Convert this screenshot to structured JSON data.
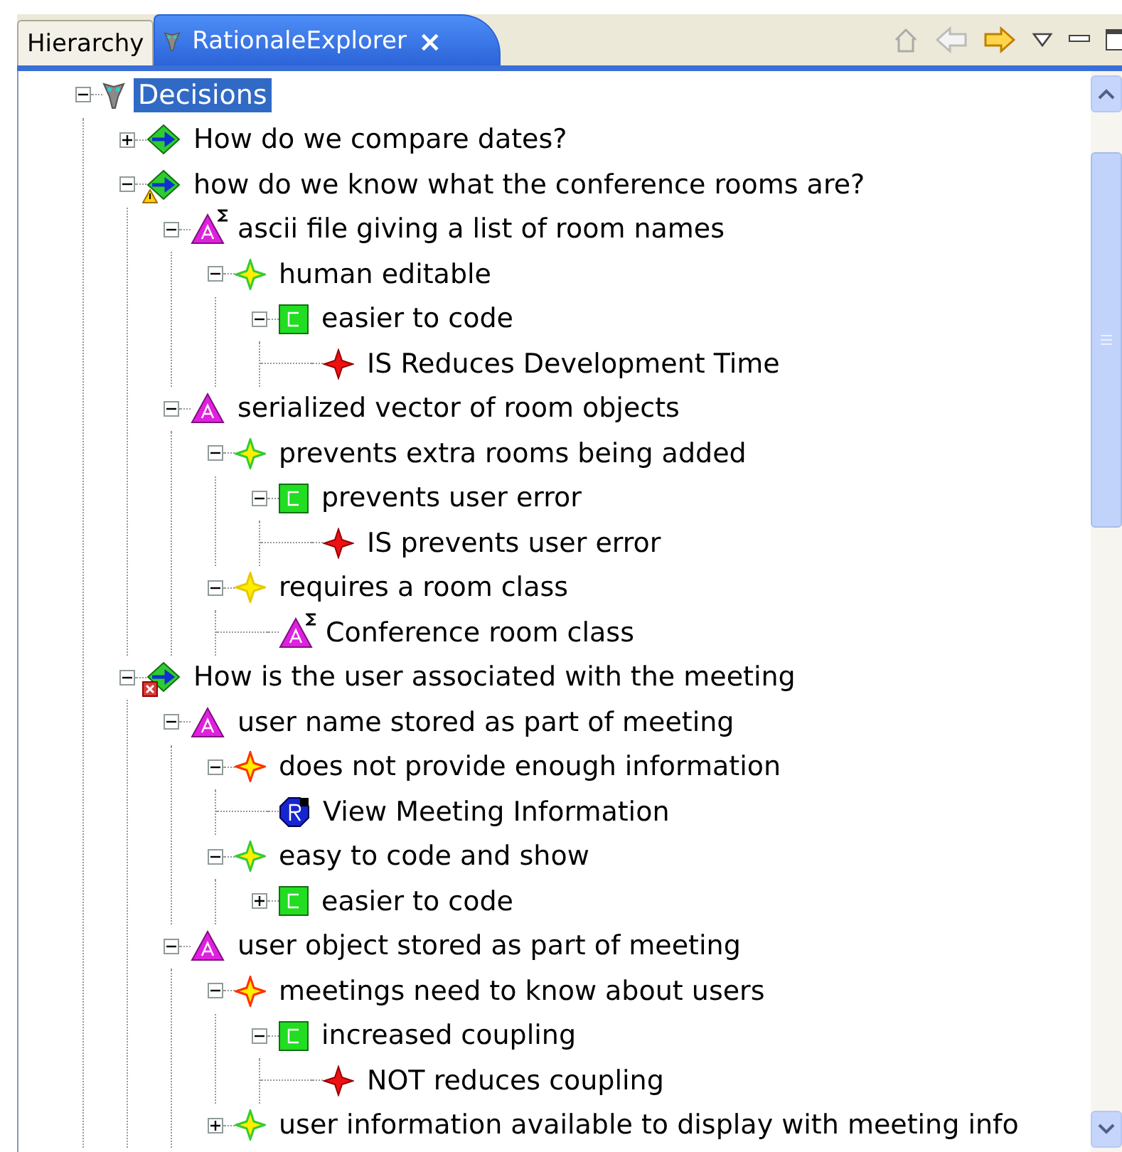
{
  "tabs": [
    {
      "label": "Hierarchy",
      "selected": false,
      "closable": false
    },
    {
      "label": "RationaleExplorer",
      "selected": true,
      "closable": true,
      "close": "×"
    }
  ],
  "toolbar": [
    {
      "kind": "home",
      "disabled": true
    },
    {
      "kind": "back",
      "disabled": true
    },
    {
      "kind": "forward",
      "disabled": false
    },
    {
      "kind": "menu"
    },
    {
      "kind": "minimize"
    },
    {
      "kind": "maximize"
    }
  ],
  "tree": [
    {
      "label": "Decisions",
      "kind": "root",
      "selected": true,
      "expanded": true,
      "children": [
        {
          "label": "How do we compare dates?",
          "kind": "decision",
          "selected": false,
          "expanded": false
        },
        {
          "label": "how do we know what the conference rooms are?",
          "kind": "decision",
          "warning": true,
          "selected": false,
          "expanded": true,
          "children": [
            {
              "label": "ascii file giving a list of room names",
              "kind": "alternative",
              "sigma": true,
              "selected": false,
              "expanded": true,
              "children": [
                {
                  "label": "human editable",
                  "kind": "argument",
                  "color": "#33cc33",
                  "selected": false,
                  "expanded": true,
                  "children": [
                    {
                      "label": "easier to code",
                      "kind": "claim",
                      "selected": false,
                      "expanded": true,
                      "children": [
                        {
                          "label": "IS Reduces Development Time",
                          "kind": "requirement",
                          "selected": false
                        }
                      ]
                    }
                  ]
                }
              ]
            },
            {
              "label": "serialized vector of room objects",
              "kind": "alternative",
              "selected": false,
              "expanded": true,
              "children": [
                {
                  "label": "prevents extra rooms being added",
                  "kind": "argument",
                  "color": "#33cc33",
                  "selected": false,
                  "expanded": true,
                  "children": [
                    {
                      "label": "prevents user error",
                      "kind": "claim",
                      "selected": false,
                      "expanded": true,
                      "children": [
                        {
                          "label": "IS prevents user error",
                          "kind": "requirement",
                          "selected": false
                        }
                      ]
                    }
                  ]
                },
                {
                  "label": "requires a room class",
                  "kind": "argument",
                  "color": "#e6c800",
                  "selected": false,
                  "expanded": true,
                  "children": [
                    {
                      "label": "Conference room class",
                      "kind": "alternative",
                      "sigma": true,
                      "selected": false
                    }
                  ]
                }
              ]
            }
          ]
        },
        {
          "label": "How is the user associated with the meeting",
          "kind": "decision",
          "error": true,
          "selected": false,
          "expanded": true,
          "children": [
            {
              "label": "user name stored as part of meeting",
              "kind": "alternative",
              "selected": false,
              "expanded": true,
              "children": [
                {
                  "label": "does not provide enough information",
                  "kind": "argument",
                  "color": "#ff3300",
                  "selected": false,
                  "expanded": true,
                  "children": [
                    {
                      "label": "View Meeting Information",
                      "kind": "reference",
                      "selected": false
                    }
                  ]
                },
                {
                  "label": "easy to code and show",
                  "kind": "argument",
                  "color": "#33cc33",
                  "selected": false,
                  "expanded": true,
                  "children": [
                    {
                      "label": "easier to code",
                      "kind": "claim",
                      "selected": false,
                      "expanded": false
                    }
                  ]
                }
              ]
            },
            {
              "label": "user object stored as part of meeting",
              "kind": "alternative",
              "selected": false,
              "expanded": true,
              "children": [
                {
                  "label": "meetings need to know about users",
                  "kind": "argument",
                  "color": "#ff3300",
                  "selected": false,
                  "expanded": true,
                  "children": [
                    {
                      "label": "increased coupling",
                      "kind": "claim",
                      "selected": false,
                      "expanded": true,
                      "children": [
                        {
                          "label": "NOT reduces coupling",
                          "kind": "requirement",
                          "selected": false
                        }
                      ]
                    }
                  ]
                },
                {
                  "label": "user information available to display with meeting info",
                  "kind": "argument",
                  "color": "#33cc33",
                  "selected": false,
                  "expanded": false
                }
              ]
            }
          ]
        }
      ]
    }
  ]
}
